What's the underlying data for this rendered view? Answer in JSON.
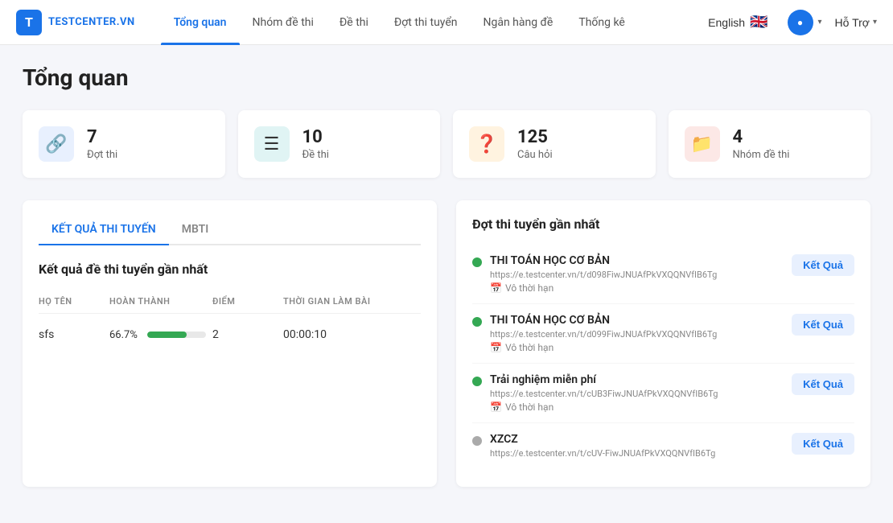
{
  "navbar": {
    "logo_text": "TESTCENTER.VN",
    "nav_items": [
      {
        "label": "Tổng quan",
        "active": true
      },
      {
        "label": "Nhóm đề thi",
        "active": false
      },
      {
        "label": "Đề thi",
        "active": false
      },
      {
        "label": "Đợt thi tuyển",
        "active": false
      },
      {
        "label": "Ngân hàng đề",
        "active": false
      },
      {
        "label": "Thống kê",
        "active": false
      }
    ],
    "language": "English",
    "flag_emoji": "🇬🇧",
    "help_label": "Hỗ Trợ"
  },
  "page": {
    "title": "Tổng quan"
  },
  "stat_cards": [
    {
      "number": "7",
      "label": "Đợt thi",
      "icon": "🔗",
      "icon_class": "blue"
    },
    {
      "number": "10",
      "label": "Đề thi",
      "icon": "☰",
      "icon_class": "teal"
    },
    {
      "number": "125",
      "label": "Câu hỏi",
      "icon": "❓",
      "icon_class": "orange"
    },
    {
      "number": "4",
      "label": "Nhóm đề thi",
      "icon": "📁",
      "icon_class": "red"
    }
  ],
  "left_panel": {
    "tabs": [
      {
        "label": "KẾT QUẢ THI TUYẾN",
        "active": true
      },
      {
        "label": "MBTI",
        "active": false
      }
    ],
    "section_title": "Kết quả đề thi tuyển gần nhất",
    "table_headers": [
      "HỌ TÊN",
      "HOÀN THÀNH",
      "ĐIỂM",
      "THỜI GIAN LÀM BÀI"
    ],
    "table_rows": [
      {
        "name": "sfs",
        "completion_pct": "66.7%",
        "progress_fill": 67,
        "score": "2",
        "time": "00:00:10"
      }
    ]
  },
  "right_panel": {
    "title": "Đợt thi tuyển gần nhất",
    "items": [
      {
        "name": "THI TOÁN HỌC CƠ BẢN",
        "url": "https://e.testcenter.vn/t/d098FiwJNUAfPkVXQQNVfIB6Tg",
        "time_label": "Vô thời hạn",
        "status": "green",
        "btn_label": "Kết Quả"
      },
      {
        "name": "THI TOÁN HỌC CƠ BẢN",
        "url": "https://e.testcenter.vn/t/d099FiwJNUAfPkVXQQNVfIB6Tg",
        "time_label": "Vô thời hạn",
        "status": "green",
        "btn_label": "Kết Quả"
      },
      {
        "name": "Trải nghiệm miễn phí",
        "url": "https://e.testcenter.vn/t/cUB3FiwJNUAfPkVXQQNVfIB6Tg",
        "time_label": "Vô thời hạn",
        "status": "green",
        "btn_label": "Kết Quả"
      },
      {
        "name": "XZCZ",
        "url": "https://e.testcenter.vn/t/cUV-FiwJNUAfPkVXQQNVfIB6Tg",
        "time_label": "",
        "status": "gray",
        "btn_label": "Kết Quả"
      }
    ]
  }
}
